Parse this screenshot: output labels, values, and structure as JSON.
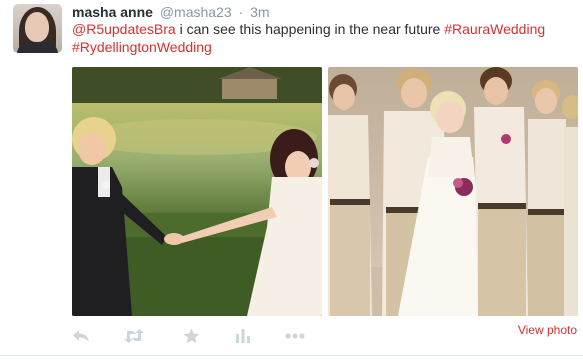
{
  "tweet": {
    "fullname": "masha anne",
    "username": "@masha23",
    "separator": "·",
    "time": "3m",
    "mention": "@R5updatesBra",
    "body": " i can see this happening in the near future ",
    "hashtag1": "#RauraWedding",
    "hashtag2": "#RydellingtonWedding",
    "view_photo": "View photo"
  },
  "actions": [
    "reply-icon",
    "retweet-icon",
    "favorite-icon",
    "analytics-icon",
    "more-icon"
  ],
  "colors": {
    "link": "#d9302e",
    "muted": "#8899a6",
    "icon": "#ccd6dd",
    "text": "#292f33"
  }
}
